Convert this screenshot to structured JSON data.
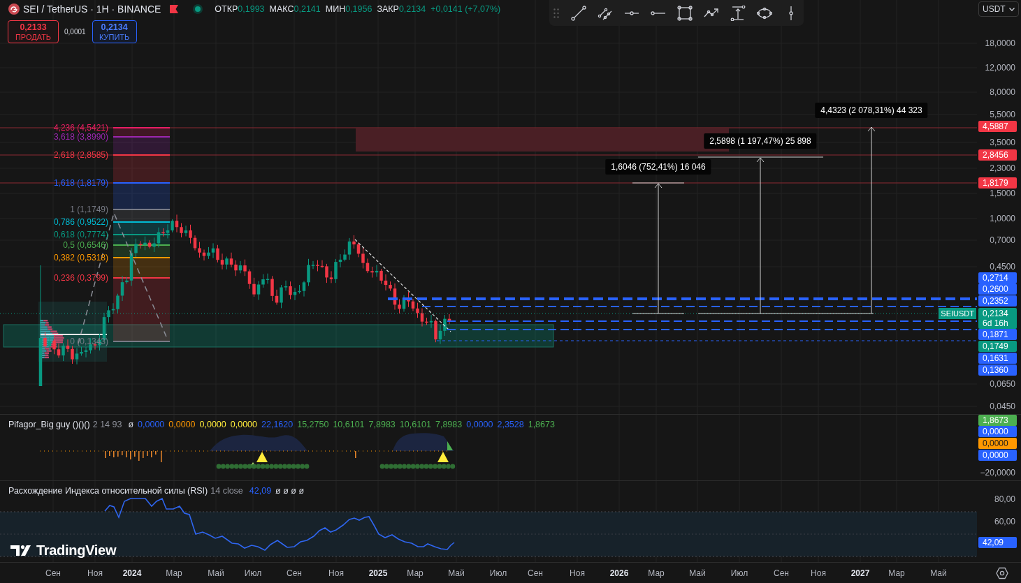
{
  "header": {
    "symbol": "SEI / TetherUS · 1H · BINANCE",
    "ohlc": [
      {
        "label": "ОТКР",
        "value": "0,1993"
      },
      {
        "label": "МАКС",
        "value": "0,2141"
      },
      {
        "label": "МИН",
        "value": "0,1956"
      },
      {
        "label": "ЗАКР",
        "value": "0,2134"
      }
    ],
    "change": "+0,0141 (+7,07%)"
  },
  "trade": {
    "sell": {
      "price": "0,2133",
      "label": "ПРОДАТЬ"
    },
    "spread": "0,0001",
    "buy": {
      "price": "0,2134",
      "label": "КУПИТЬ"
    }
  },
  "currency": "USDT",
  "fib_levels": [
    {
      "label": "4,236 (4,5421)",
      "color": "#e91e63"
    },
    {
      "label": "3,618 (3,8990)",
      "color": "#9c27b0"
    },
    {
      "label": "2,618 (2,8585)",
      "color": "#f23645"
    },
    {
      "label": "1,618 (1,8179)",
      "color": "#2962ff"
    },
    {
      "label": "1 (1,1749)",
      "color": "#787b86"
    },
    {
      "label": "0,786 (0,9522)",
      "color": "#00bcd4"
    },
    {
      "label": "0,618 (0,7774)",
      "color": "#089981"
    },
    {
      "label": "0,5 (0,6546)",
      "color": "#4caf50"
    },
    {
      "label": "0,382 (0,5318)",
      "color": "#ff9800"
    },
    {
      "label": "0,236 (0,3799)",
      "color": "#f23645"
    },
    {
      "label": "0 (0,1343)",
      "color": "#787b86"
    }
  ],
  "measurements": [
    {
      "label": "1,6046 (752,41%) 16 046"
    },
    {
      "label": "2,5898 (1 197,47%) 25 898"
    },
    {
      "label": "4,4323 (2 078,31%) 44 323"
    }
  ],
  "symbol_tag": "SEIUSDT",
  "price_scale": [
    {
      "label": "18,0000",
      "kind": "tick"
    },
    {
      "label": "12,0000",
      "kind": "tick"
    },
    {
      "label": "8,0000",
      "kind": "tick"
    },
    {
      "label": "5,5000",
      "kind": "tick"
    },
    {
      "label": "4,5887",
      "kind": "badge",
      "color": "#f23645"
    },
    {
      "label": "3,5000",
      "kind": "tick"
    },
    {
      "label": "2,8456",
      "kind": "badge",
      "color": "#f23645"
    },
    {
      "label": "2,3000",
      "kind": "tick"
    },
    {
      "label": "1,8179",
      "kind": "badge",
      "color": "#f23645"
    },
    {
      "label": "1,5000",
      "kind": "tick"
    },
    {
      "label": "1,0000",
      "kind": "tick"
    },
    {
      "label": "0,7000",
      "kind": "tick"
    },
    {
      "label": "0,4500",
      "kind": "tick"
    },
    {
      "label": "0,2714",
      "kind": "badge",
      "color": "#2962ff"
    },
    {
      "label": "0,2600",
      "kind": "badge",
      "color": "#2962ff"
    },
    {
      "label": "0,2352",
      "kind": "badge",
      "color": "#2962ff"
    },
    {
      "label": "0,2134",
      "kind": "current",
      "countdown": "6d 16h",
      "color": "#089981"
    },
    {
      "label": "0,1871",
      "kind": "badge",
      "color": "#2962ff"
    },
    {
      "label": "0,1749",
      "kind": "badge",
      "color": "#089981"
    },
    {
      "label": "0,1631",
      "kind": "badge",
      "color": "#2962ff"
    },
    {
      "label": "0,1360",
      "kind": "badge",
      "color": "#2962ff"
    },
    {
      "label": "0,0650",
      "kind": "tick"
    },
    {
      "label": "0,0450",
      "kind": "tick"
    }
  ],
  "indicators": [
    {
      "name": "Pifagor_Big guy ()()()",
      "params": "2 14 93",
      "values": [
        {
          "text": "ø",
          "color": "#d1d4dc"
        },
        {
          "text": "0,0000",
          "color": "#2962ff"
        },
        {
          "text": "0,0000",
          "color": "#ff9800"
        },
        {
          "text": "0,0000",
          "color": "#ffeb3b"
        },
        {
          "text": "0,0000",
          "color": "#ffeb3b"
        },
        {
          "text": "22,1620",
          "color": "#2962ff"
        },
        {
          "text": "15,2750",
          "color": "#4caf50"
        },
        {
          "text": "10,6101",
          "color": "#4caf50"
        },
        {
          "text": "7,8983",
          "color": "#4caf50"
        },
        {
          "text": "10,6101",
          "color": "#4caf50"
        },
        {
          "text": "7,8983",
          "color": "#4caf50"
        },
        {
          "text": "0,0000",
          "color": "#2962ff"
        },
        {
          "text": "2,3528",
          "color": "#2962ff"
        },
        {
          "text": "1,8673",
          "color": "#4caf50"
        }
      ],
      "scale": [
        {
          "label": "1,8673",
          "kind": "badge",
          "color": "#4caf50"
        },
        {
          "label": "0,0000",
          "kind": "badge",
          "color": "#2962ff"
        },
        {
          "label": "0,0000",
          "kind": "badge",
          "color": "#ff9800"
        },
        {
          "label": "0,0000",
          "kind": "badge",
          "color": "#2962ff"
        },
        {
          "label": "−20,0000",
          "kind": "tick"
        }
      ]
    },
    {
      "name": "Расхождение Индекса относительной силы (RSI)",
      "params": "14 close",
      "values": [
        {
          "text": "42,09",
          "color": "#2962ff"
        },
        {
          "text": "ø ø ø ø",
          "color": "#d1d4dc"
        }
      ],
      "scale": [
        {
          "label": "80,00",
          "kind": "tick"
        },
        {
          "label": "60,00",
          "kind": "tick"
        },
        {
          "label": "42,09",
          "kind": "badge",
          "color": "#2962ff"
        }
      ]
    }
  ],
  "logo": "TradingView",
  "time_scale": [
    {
      "label": "Сен",
      "kind": "month"
    },
    {
      "label": "Ноя",
      "kind": "month"
    },
    {
      "label": "2024",
      "kind": "year"
    },
    {
      "label": "Мар",
      "kind": "month"
    },
    {
      "label": "Май",
      "kind": "month"
    },
    {
      "label": "Июл",
      "kind": "month"
    },
    {
      "label": "Сен",
      "kind": "month"
    },
    {
      "label": "Ноя",
      "kind": "month"
    },
    {
      "label": "2025",
      "kind": "year"
    },
    {
      "label": "Мар",
      "kind": "month"
    },
    {
      "label": "Май",
      "kind": "month"
    },
    {
      "label": "Июл",
      "kind": "month"
    },
    {
      "label": "Сен",
      "kind": "month"
    },
    {
      "label": "Ноя",
      "kind": "month"
    },
    {
      "label": "2026",
      "kind": "year"
    },
    {
      "label": "Мар",
      "kind": "month"
    },
    {
      "label": "Май",
      "kind": "month"
    },
    {
      "label": "Июл",
      "kind": "month"
    },
    {
      "label": "Сен",
      "kind": "month"
    },
    {
      "label": "Ноя",
      "kind": "month"
    },
    {
      "label": "2027",
      "kind": "year"
    },
    {
      "label": "Мар",
      "kind": "month"
    },
    {
      "label": "Май",
      "kind": "month"
    }
  ]
}
